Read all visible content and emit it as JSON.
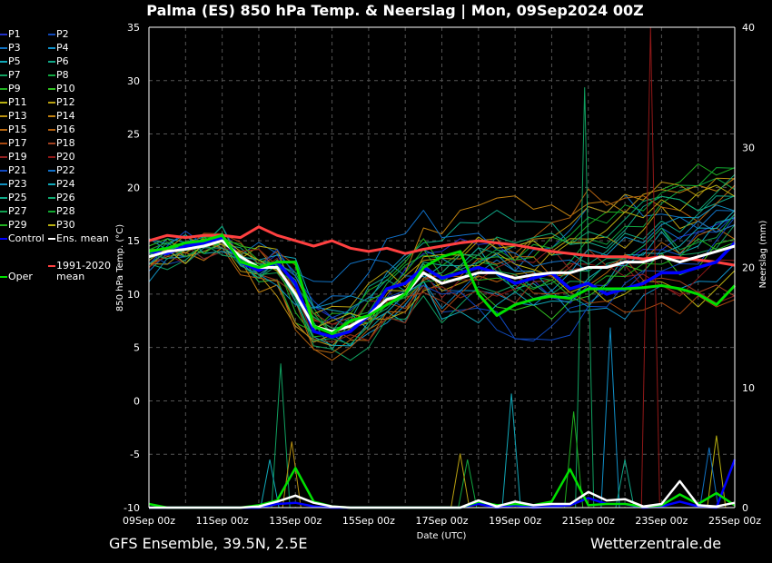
{
  "title": "Palma  (ES)  850 hPa Temp. & Neerslag | Mon, 09Sep2024 00Z",
  "footer_left": "GFS Ensemble, 39.5N, 2.5E",
  "footer_right": "Wetterzentrale.de",
  "legend": [
    {
      "label": "P1",
      "color": "#2030c8"
    },
    {
      "label": "P2",
      "color": "#1048b8"
    },
    {
      "label": "P3",
      "color": "#1070c0"
    },
    {
      "label": "P4",
      "color": "#1090c8"
    },
    {
      "label": "P5",
      "color": "#10a8b8"
    },
    {
      "label": "P6",
      "color": "#10a888"
    },
    {
      "label": "P7",
      "color": "#10a060"
    },
    {
      "label": "P8",
      "color": "#10a840"
    },
    {
      "label": "P9",
      "color": "#20b020"
    },
    {
      "label": "P10",
      "color": "#30c020"
    },
    {
      "label": "P11",
      "color": "#b8b010"
    },
    {
      "label": "P12",
      "color": "#b8a010"
    },
    {
      "label": "P13",
      "color": "#b89010"
    },
    {
      "label": "P14",
      "color": "#c08010"
    },
    {
      "label": "P15",
      "color": "#b86810"
    },
    {
      "label": "P16",
      "color": "#b06010"
    },
    {
      "label": "P17",
      "color": "#a84810"
    },
    {
      "label": "P18",
      "color": "#a04020"
    },
    {
      "label": "P19",
      "color": "#902020"
    },
    {
      "label": "P20",
      "color": "#901818"
    },
    {
      "label": "P21",
      "color": "#1048c0"
    },
    {
      "label": "P22",
      "color": "#1070c8"
    },
    {
      "label": "P23",
      "color": "#1090c0"
    },
    {
      "label": "P24",
      "color": "#10a8b8"
    },
    {
      "label": "P25",
      "color": "#10a888"
    },
    {
      "label": "P26",
      "color": "#10a870"
    },
    {
      "label": "P27",
      "color": "#10a050"
    },
    {
      "label": "P28",
      "color": "#10a830"
    },
    {
      "label": "P29",
      "color": "#20b020"
    },
    {
      "label": "P30",
      "color": "#b8b010"
    },
    {
      "label": "Control",
      "color": "#0000ff"
    },
    {
      "label": "Ens. mean",
      "color": "#ffffff"
    },
    {
      "label": "Oper",
      "color": "#00e000"
    },
    {
      "label": "1991-2020\nmean",
      "color": "#ff4040"
    }
  ],
  "chart_data": {
    "type": "line",
    "title": "Palma  (ES)  850 hPa Temp. & Neerslag | Mon, 09Sep2024 00Z",
    "xlabel": "Date (UTC)",
    "ylabel": "850 hPa Temp. (°C)",
    "y2label": "Neerslag (mm)",
    "ylim": [
      -10,
      35
    ],
    "y2lim": [
      0,
      40
    ],
    "yticks": [
      "35",
      "30",
      "25",
      "20",
      "15",
      "10",
      "5",
      "0",
      "-5",
      "-10"
    ],
    "y2ticks": [
      "40",
      "30",
      "20",
      "10",
      "0"
    ],
    "xticks": [
      "09Sep 00z",
      "11Sep 00z",
      "13Sep 00z",
      "15Sep 00z",
      "17Sep 00z",
      "19Sep 00z",
      "21Sep 00z",
      "23Sep 00z",
      "25Sep 00z"
    ],
    "grid": true,
    "step_hours": 12,
    "ens_mean": [
      13.5,
      14,
      14.2,
      14.5,
      15,
      13.5,
      12.5,
      12.5,
      10,
      7,
      6.5,
      7,
      8,
      9.5,
      10,
      12,
      11,
      11.5,
      12,
      12,
      11.5,
      11.8,
      12,
      12,
      12.5,
      12.5,
      13,
      13,
      13.5,
      13,
      13.5,
      14,
      14.5
    ],
    "control": [
      14,
      13.8,
      14.5,
      14.8,
      15.3,
      13,
      12.2,
      13,
      11,
      6.5,
      6,
      6.5,
      8,
      10.5,
      11,
      12.5,
      11.5,
      12,
      12.5,
      12,
      11,
      11.5,
      12,
      10.5,
      11,
      10,
      10.5,
      11,
      12,
      12,
      12.5,
      13,
      14.8
    ],
    "oper": [
      14,
      14.3,
      14.8,
      15,
      15.5,
      13,
      12.5,
      13,
      13,
      7,
      6.3,
      7.5,
      8,
      9,
      10,
      12.5,
      13.5,
      14,
      10,
      8,
      9,
      9.5,
      9.8,
      9.6,
      10.5,
      10.5,
      10.5,
      10.6,
      10.8,
      10.5,
      10,
      9,
      10.8
    ],
    "climate_mean": [
      15,
      15.5,
      15.3,
      15.5,
      15.5,
      15.3,
      16.3,
      15.5,
      15,
      14.5,
      15,
      14.3,
      14,
      14.3,
      13.8,
      14.2,
      14.5,
      14.8,
      15,
      14.8,
      14.6,
      14.3,
      14,
      13.8,
      13.6,
      13.5,
      13.5,
      13.3,
      13.5,
      13.4,
      13.2,
      13,
      12.7
    ],
    "member_offsets_daily": [
      [
        0,
        0,
        1,
        0,
        1,
        2,
        -1,
        2,
        3,
        3,
        2,
        -3,
        -2,
        0,
        1,
        3,
        2
      ],
      [
        0,
        -1,
        0,
        1,
        -1,
        1,
        0,
        -1,
        -2,
        -4,
        -6,
        -5,
        -3,
        -2,
        0,
        2,
        3
      ],
      [
        -1,
        0,
        -1,
        2,
        2,
        5,
        6,
        1,
        -1,
        0,
        1,
        3,
        5,
        6,
        4,
        3,
        4
      ],
      [
        1,
        0,
        -1,
        -1,
        -2,
        -1,
        -2,
        -1,
        -2,
        -1,
        -3,
        -2,
        -4,
        -5,
        -2,
        -3,
        -2
      ],
      [
        0,
        1,
        0,
        0,
        3,
        2,
        -1,
        -2,
        1,
        2,
        -1,
        -2,
        -3,
        0,
        2,
        1,
        3
      ],
      [
        0,
        0,
        1,
        -1,
        1,
        -1,
        2,
        3,
        4,
        5,
        6,
        4,
        2,
        3,
        6,
        5,
        4
      ],
      [
        -1,
        -1,
        0,
        1,
        -1,
        -2,
        -3,
        -2,
        -3,
        -2,
        -1,
        -2,
        -1,
        1,
        2,
        0,
        2
      ],
      [
        0,
        1,
        -1,
        0,
        2,
        0,
        1,
        2,
        2,
        1,
        -1,
        0,
        2,
        3,
        5,
        7,
        6
      ],
      [
        0,
        0,
        0,
        -1,
        -2,
        1,
        2,
        3,
        2,
        2,
        1,
        3,
        4,
        5,
        7,
        8,
        7
      ],
      [
        1,
        0,
        1,
        1,
        0,
        -1,
        -2,
        -2,
        -1,
        -2,
        -3,
        -4,
        -2,
        -1,
        0,
        -1,
        1
      ],
      [
        0,
        -1,
        -1,
        2,
        0,
        1,
        -1,
        -2,
        0,
        1,
        2,
        -1,
        -2,
        -3,
        -2,
        -4,
        -3
      ],
      [
        -1,
        0,
        0,
        0,
        1,
        2,
        3,
        1,
        0,
        -1,
        0,
        2,
        3,
        2,
        4,
        3,
        2
      ],
      [
        0,
        0,
        -1,
        -1,
        -3,
        -1,
        0,
        1,
        2,
        3,
        2,
        4,
        5,
        6,
        7,
        6,
        7
      ],
      [
        0,
        1,
        0,
        -2,
        -2,
        -1,
        1,
        2,
        5,
        7,
        7,
        6,
        6,
        5,
        7,
        6,
        6
      ],
      [
        -1,
        0,
        0,
        1,
        -1,
        -2,
        -2,
        -1,
        0,
        1,
        2,
        0,
        -1,
        0,
        1,
        2,
        1
      ],
      [
        0,
        -1,
        -1,
        -1,
        -3,
        -2,
        -2,
        -1,
        1,
        2,
        3,
        4,
        7,
        6,
        5,
        4,
        5
      ],
      [
        0,
        0,
        1,
        1,
        2,
        0,
        -1,
        -1,
        -2,
        -1,
        0,
        -2,
        -3,
        -4,
        -5,
        -4,
        -5
      ],
      [
        1,
        0,
        0,
        -1,
        0,
        1,
        0,
        -1,
        -2,
        -3,
        -2,
        0,
        1,
        0,
        -2,
        -3,
        -4
      ],
      [
        0,
        0,
        -1,
        0,
        1,
        0,
        1,
        0,
        -1,
        0,
        1,
        2,
        0,
        -1,
        -2,
        -4,
        -5
      ],
      [
        -1,
        -1,
        0,
        1,
        0,
        -1,
        -2,
        -2,
        -1,
        -2,
        -1,
        0,
        1,
        -1,
        -3,
        -2,
        -1
      ],
      [
        0,
        1,
        0,
        0,
        2,
        2,
        1,
        0,
        -1,
        -3,
        -5,
        -7,
        -4,
        -2,
        -1,
        0,
        2
      ],
      [
        0,
        0,
        -1,
        0,
        1,
        3,
        4,
        6,
        5,
        3,
        2,
        1,
        0,
        1,
        2,
        3,
        2
      ],
      [
        -2,
        0,
        0,
        -1,
        -1,
        3,
        2,
        3,
        2,
        1,
        1,
        -1,
        1,
        2,
        3,
        4,
        4
      ],
      [
        1,
        1,
        -1,
        0,
        0,
        -2,
        -1,
        0,
        -3,
        -4,
        -2,
        -3,
        -1,
        0,
        1,
        2,
        3
      ],
      [
        0,
        -1,
        0,
        0,
        1,
        0,
        2,
        1,
        1,
        2,
        3,
        2,
        1,
        2,
        3,
        4,
        5
      ],
      [
        0,
        0,
        1,
        -1,
        0,
        1,
        -1,
        0,
        1,
        2,
        4,
        3,
        3,
        4,
        6,
        5,
        6
      ],
      [
        0,
        0,
        -1,
        0,
        -1,
        -1,
        -1,
        0,
        1,
        1,
        0,
        -1,
        0,
        1,
        2,
        1,
        3
      ],
      [
        1,
        0,
        0,
        0,
        1,
        0,
        0,
        -1,
        0,
        1,
        2,
        3,
        4,
        5,
        6,
        7,
        8
      ],
      [
        0,
        0,
        0,
        1,
        -1,
        -1,
        1,
        2,
        1,
        0,
        -1,
        -1,
        -2,
        -1,
        0,
        1,
        0
      ],
      [
        0,
        -1,
        1,
        0,
        0,
        1,
        0,
        1,
        2,
        3,
        3,
        2,
        3,
        4,
        5,
        6,
        5
      ]
    ],
    "precip_mean": [
      0,
      0,
      0,
      0,
      0,
      0,
      0.1,
      0.5,
      1.0,
      0.4,
      0.1,
      0,
      0,
      0,
      0,
      0,
      0,
      0,
      0.6,
      0.1,
      0.5,
      0.2,
      0.3,
      0.3,
      1.3,
      0.6,
      0.7,
      0.1,
      0.3,
      2.2,
      0.2,
      0.1,
      0.4
    ],
    "precip_oper": [
      0.3,
      0,
      0,
      0,
      0,
      0,
      0.2,
      0.6,
      3.3,
      0.5,
      0.1,
      0,
      0,
      0,
      0,
      0,
      0,
      0,
      0.5,
      0.2,
      0.3,
      0.2,
      0.5,
      3.2,
      0.2,
      0.3,
      0.3,
      0.1,
      0.2,
      1.1,
      0.3,
      1.2,
      0.2
    ],
    "precip_control": [
      0,
      0,
      0,
      0,
      0,
      0,
      0,
      0.3,
      0.4,
      0.1,
      0,
      0,
      0,
      0,
      0,
      0,
      0,
      0,
      0.3,
      0,
      0.2,
      0,
      0.1,
      0.2,
      0.8,
      0.3,
      0.3,
      0,
      0.1,
      0.5,
      0.1,
      0,
      4
    ],
    "precip_spikes": [
      {
        "member": "P7",
        "day": 3.6,
        "mm": 12
      },
      {
        "member": "P13",
        "day": 3.9,
        "mm": 5.5
      },
      {
        "member": "P5",
        "day": 3.3,
        "mm": 4
      },
      {
        "member": "P24",
        "day": 9.9,
        "mm": 9.5
      },
      {
        "member": "P8",
        "day": 8.7,
        "mm": 4
      },
      {
        "member": "P12",
        "day": 8.5,
        "mm": 4.5
      },
      {
        "member": "P7",
        "day": 11.9,
        "mm": 35
      },
      {
        "member": "P9",
        "day": 11.6,
        "mm": 8
      },
      {
        "member": "P4",
        "day": 12.6,
        "mm": 15
      },
      {
        "member": "P20",
        "day": 13.7,
        "mm": 40
      },
      {
        "member": "P6",
        "day": 13,
        "mm": 4
      },
      {
        "member": "P30",
        "day": 15.5,
        "mm": 6
      },
      {
        "member": "P3",
        "day": 15.3,
        "mm": 5
      }
    ]
  }
}
